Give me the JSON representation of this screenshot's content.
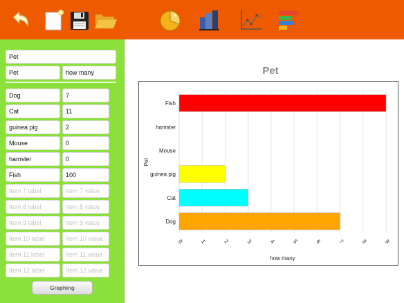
{
  "toolbar": {
    "buttons": [
      {
        "name": "undo-icon",
        "color": "#fff3c8"
      },
      {
        "name": "new-document-icon",
        "color": "#ffffff"
      },
      {
        "name": "save-icon",
        "color": "#222222"
      },
      {
        "name": "open-folder-icon",
        "color": "#f6c445"
      },
      {
        "name": "pie-chart-icon",
        "color": "#f3b21a"
      },
      {
        "name": "bar-chart-icon",
        "color": "#3a5fa8"
      },
      {
        "name": "line-chart-icon",
        "color": "#555555"
      },
      {
        "name": "horizontal-bar-chart-icon",
        "color": "#e8432e"
      }
    ]
  },
  "form": {
    "title_value": "Pet",
    "label_header": "Pet",
    "value_header": "how many",
    "items": [
      {
        "label": "Dog",
        "value": "7",
        "label_placeholder": "",
        "value_placeholder": ""
      },
      {
        "label": "Cat",
        "value": "11",
        "label_placeholder": "",
        "value_placeholder": ""
      },
      {
        "label": "guinea pig",
        "value": "2",
        "label_placeholder": "",
        "value_placeholder": ""
      },
      {
        "label": "Mouse",
        "value": "0",
        "label_placeholder": "",
        "value_placeholder": ""
      },
      {
        "label": "hamster",
        "value": "0",
        "label_placeholder": "",
        "value_placeholder": ""
      },
      {
        "label": "Fish",
        "value": "100",
        "label_placeholder": "",
        "value_placeholder": ""
      },
      {
        "label": "",
        "value": "",
        "label_placeholder": "Item  7 label",
        "value_placeholder": "Item  7 value"
      },
      {
        "label": "",
        "value": "",
        "label_placeholder": "Item  8 label",
        "value_placeholder": "Item  8 value"
      },
      {
        "label": "",
        "value": "",
        "label_placeholder": "Item  9 label",
        "value_placeholder": "Item  9 value"
      },
      {
        "label": "",
        "value": "",
        "label_placeholder": "Item  10 label",
        "value_placeholder": "Item  10 value"
      },
      {
        "label": "",
        "value": "",
        "label_placeholder": "Item  11 label",
        "value_placeholder": "Item  11 value"
      },
      {
        "label": "",
        "value": "",
        "label_placeholder": "Item  12 label",
        "value_placeholder": "Item  12 value"
      }
    ],
    "graph_button": "Graphing"
  },
  "chart_data": {
    "type": "bar",
    "orientation": "horizontal",
    "title": "Pet",
    "xlabel": "how many",
    "ylabel": "Pet",
    "categories": [
      "Dog",
      "Cat",
      "guinea pig",
      "Mouse",
      "hamster",
      "Fish"
    ],
    "values": [
      7,
      3,
      2,
      0,
      0,
      9
    ],
    "colors": [
      "#ffa500",
      "#00ffff",
      "#ffff00",
      "#999999",
      "#999999",
      "#ff0000"
    ],
    "xlim": [
      0,
      9
    ],
    "xticks": [
      "0",
      "1",
      "2",
      "3",
      "4",
      "5",
      "6",
      "7",
      "8",
      "9"
    ],
    "grid": "vertical"
  }
}
